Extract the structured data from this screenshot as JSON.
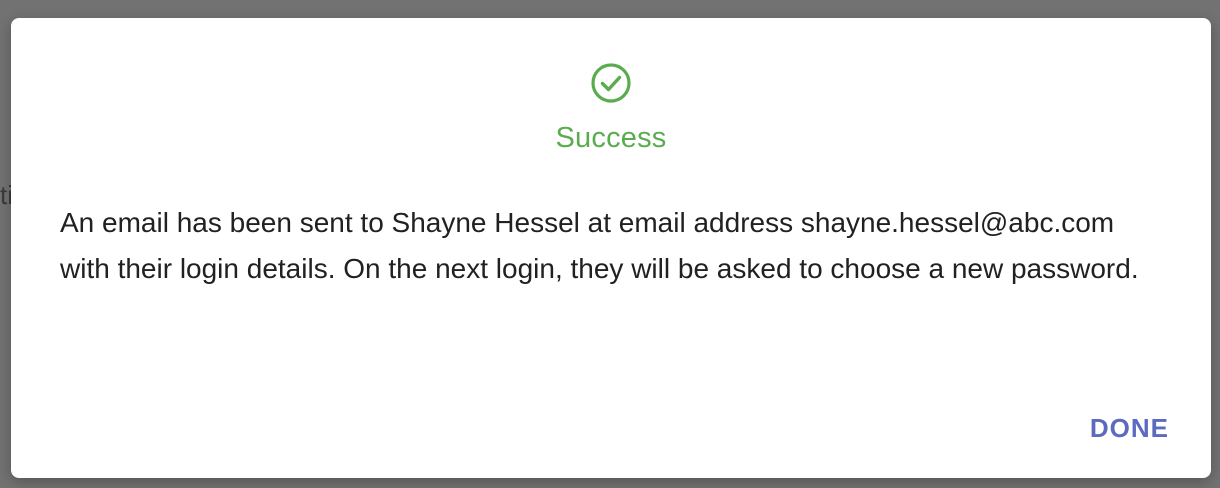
{
  "background": {
    "fragment_text": "ti"
  },
  "dialog": {
    "icon": "check-circle-icon",
    "title": "Success",
    "message": "An email has been sent to Shayne Hessel at email address shayne.hessel@abc.com with their login details. On the next login, they will be asked to choose a new password.",
    "done_label": "DONE"
  },
  "colors": {
    "success": "#5aac4f",
    "accent": "#5c6bc0",
    "text": "#212121",
    "overlay": "#727272"
  }
}
